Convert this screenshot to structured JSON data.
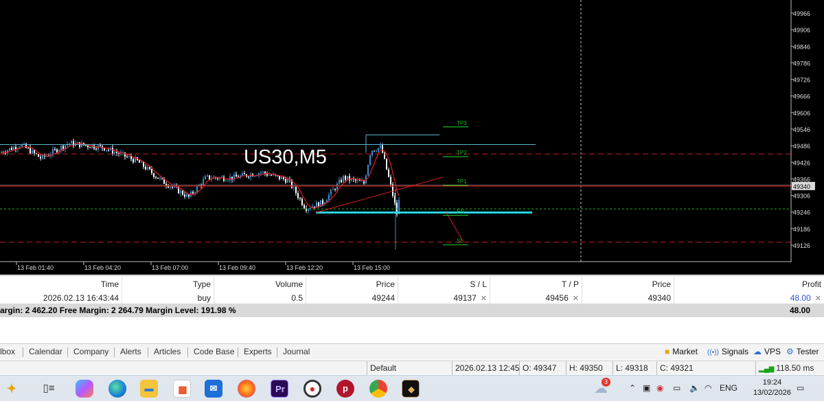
{
  "chart": {
    "title": "US30,M5",
    "colors": {
      "up": "#3d8fd6",
      "down": "#ffffff",
      "ma": "#d81e1e",
      "grid": "#777777",
      "green": "#1db41d",
      "cyan": "#29d3e0",
      "teal_line": "#5bb8d0"
    },
    "price_axis": [
      "49966",
      "49906",
      "49846",
      "49786",
      "49726",
      "49666",
      "49606",
      "49546",
      "49486",
      "49426",
      "49366",
      "49306",
      "49246",
      "49186",
      "49126"
    ],
    "current_price": "49340",
    "time_axis": [
      "13 Feb 01:40",
      "13 Feb 04:20",
      "13 Feb 07:00",
      "13 Feb 09:40",
      "13 Feb 12:20",
      "13 Feb 15:00"
    ],
    "levels": [
      {
        "label": "TP3",
        "price": 49564
      },
      {
        "label": "TP2",
        "price": 49456
      },
      {
        "label": "TP1",
        "price": 49352
      },
      {
        "label": "EN",
        "price": 49244
      },
      {
        "label": "SL",
        "price": 49137
      }
    ]
  },
  "trade": {
    "headers": {
      "time": "Time",
      "type": "Type",
      "volume": "Volume",
      "price": "Price",
      "sl": "S / L",
      "tp": "T / P",
      "price2": "Price",
      "profit": "Profit"
    },
    "row": {
      "time": "2026.02.13 16:43:44",
      "type": "buy",
      "volume": "0.5",
      "price": "49244",
      "sl": "49137",
      "tp": "49456",
      "price2": "49340",
      "profit": "48.00"
    },
    "close_mark": "✕",
    "margin_text": "argin: 2 462.20  Free Margin: 2 264.79  Margin Level: 191.98 %",
    "margin_total": "48.00"
  },
  "tabs": [
    "lbox",
    "Calendar",
    "Company",
    "Alerts",
    "Articles",
    "Code Base",
    "Experts",
    "Journal"
  ],
  "tools": {
    "market": "Market",
    "signals": "Signals",
    "vps": "VPS",
    "tester": "Tester"
  },
  "status": {
    "profile": "Default",
    "datetime": "2026.02.13 12:45",
    "open": "O: 49347",
    "high": "H: 49350",
    "low": "L: 49318",
    "close": "C: 49321",
    "ping": "118.50 ms"
  },
  "taskbar": {
    "notification_badge": "3",
    "lang": "ENG",
    "time": "19:24",
    "date": "13/02/2026",
    "premiere_label": "Pr",
    "phone_label": "p"
  }
}
